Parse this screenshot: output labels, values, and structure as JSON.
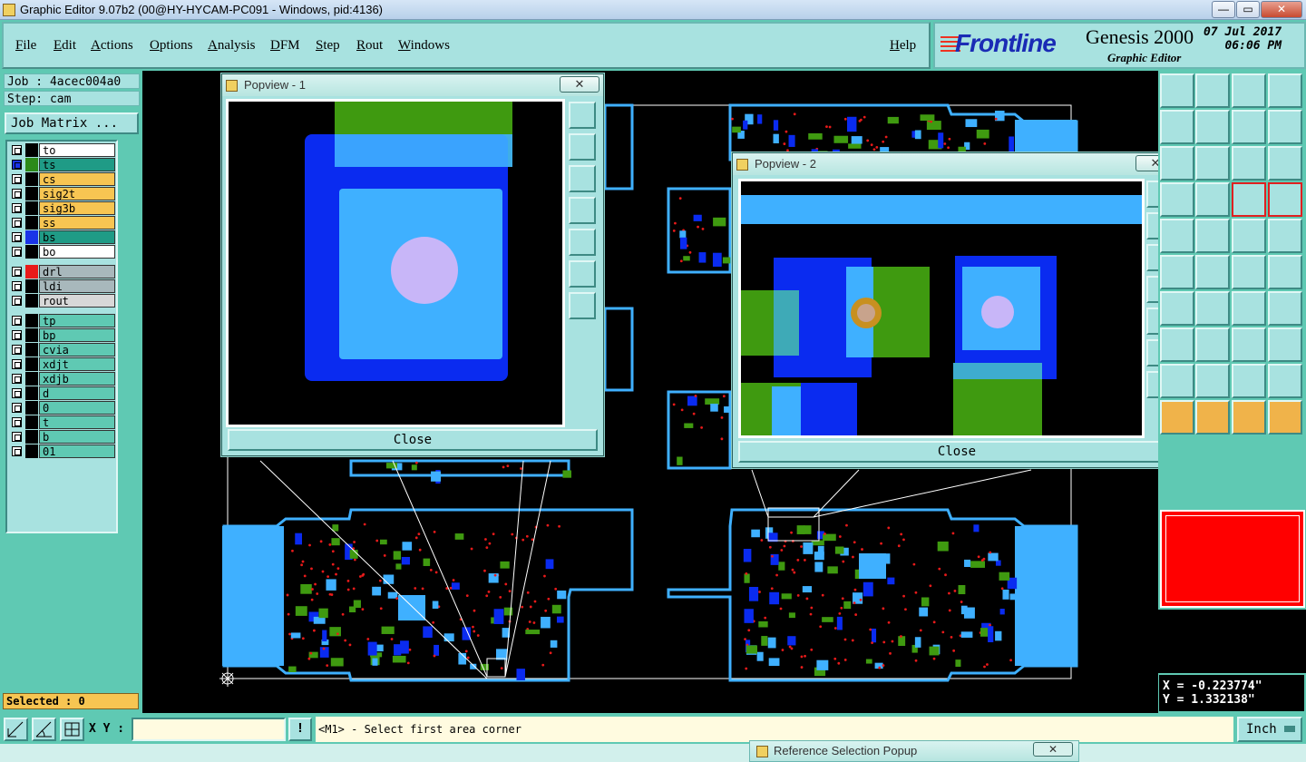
{
  "window": {
    "title": "Graphic Editor 9.07b2 (00@HY-HYCAM-PC091 - Windows, pid:4136)",
    "controls": {
      "minimize": "—",
      "restore": "▭",
      "close": "✕"
    }
  },
  "menu": {
    "items": [
      "File",
      "Edit",
      "Actions",
      "Options",
      "Analysis",
      "DFM",
      "Step",
      "Rout",
      "Windows"
    ],
    "help": "Help"
  },
  "brand": {
    "logo": "Frontline",
    "product": "Genesis 2000",
    "edition": "Graphic Editor",
    "date": "07 Jul 2017",
    "time": "06:06 PM"
  },
  "job": {
    "job_label": "Job : 4acec004a0",
    "step_label": "Step: cam",
    "matrix_button": "Job Matrix ..."
  },
  "layers": {
    "board": [
      {
        "name": "to",
        "swatch": "#000000",
        "fill": "#ffffff"
      },
      {
        "name": "ts",
        "swatch": "#2c8a1a",
        "fill": "#1f9b86",
        "active": true
      },
      {
        "name": "cs",
        "swatch": "#000000",
        "fill": "#f7c552"
      },
      {
        "name": "sig2t",
        "swatch": "#000000",
        "fill": "#f7c552"
      },
      {
        "name": "sig3b",
        "swatch": "#000000",
        "fill": "#f7c552"
      },
      {
        "name": "ss",
        "swatch": "#000000",
        "fill": "#f7c552"
      },
      {
        "name": "bs",
        "swatch": "#1a34e8",
        "fill": "#1f9b86"
      },
      {
        "name": "bo",
        "swatch": "#000000",
        "fill": "#ffffff"
      }
    ],
    "drill": [
      {
        "name": "drl",
        "swatch": "#e81a1a",
        "fill": "#a8b8bc"
      },
      {
        "name": "ldi",
        "swatch": "#000000",
        "fill": "#a8b8bc"
      },
      {
        "name": "rout",
        "swatch": "#000000",
        "fill": "#d8d8d8"
      }
    ],
    "misc": [
      {
        "name": "tp"
      },
      {
        "name": "bp"
      },
      {
        "name": "cvia"
      },
      {
        "name": "xdjt"
      },
      {
        "name": "xdjb"
      },
      {
        "name": "d"
      },
      {
        "name": "0"
      },
      {
        "name": "t"
      },
      {
        "name": "b"
      },
      {
        "name": "01"
      }
    ]
  },
  "selected": "Selected : 0",
  "popview1": {
    "title": "Popview - 1",
    "close_x": "✕",
    "close": "Close"
  },
  "popview2": {
    "title": "Popview - 2",
    "close_x": "✕",
    "close": "Close"
  },
  "coords": {
    "x": "X = -0.223774\"",
    "y": "Y = 1.332138\""
  },
  "bottom": {
    "xy_label": "X Y :",
    "xy_value": "",
    "prompt": "<M1> - Select first area corner",
    "unit": "Inch"
  },
  "taskbar": {
    "popup_title": "Reference Selection Popup",
    "close_x": "✕"
  },
  "colors": {
    "panel": "#5fc9b3",
    "button": "#a8e2e0",
    "pad_green": "#3f9a10",
    "pad_blue": "#0a2bf0",
    "pad_cyan": "#3fb0ff",
    "drill_lilac": "#c8b6f8",
    "via_red": "#e81a1a",
    "outline": "#ffffff"
  }
}
